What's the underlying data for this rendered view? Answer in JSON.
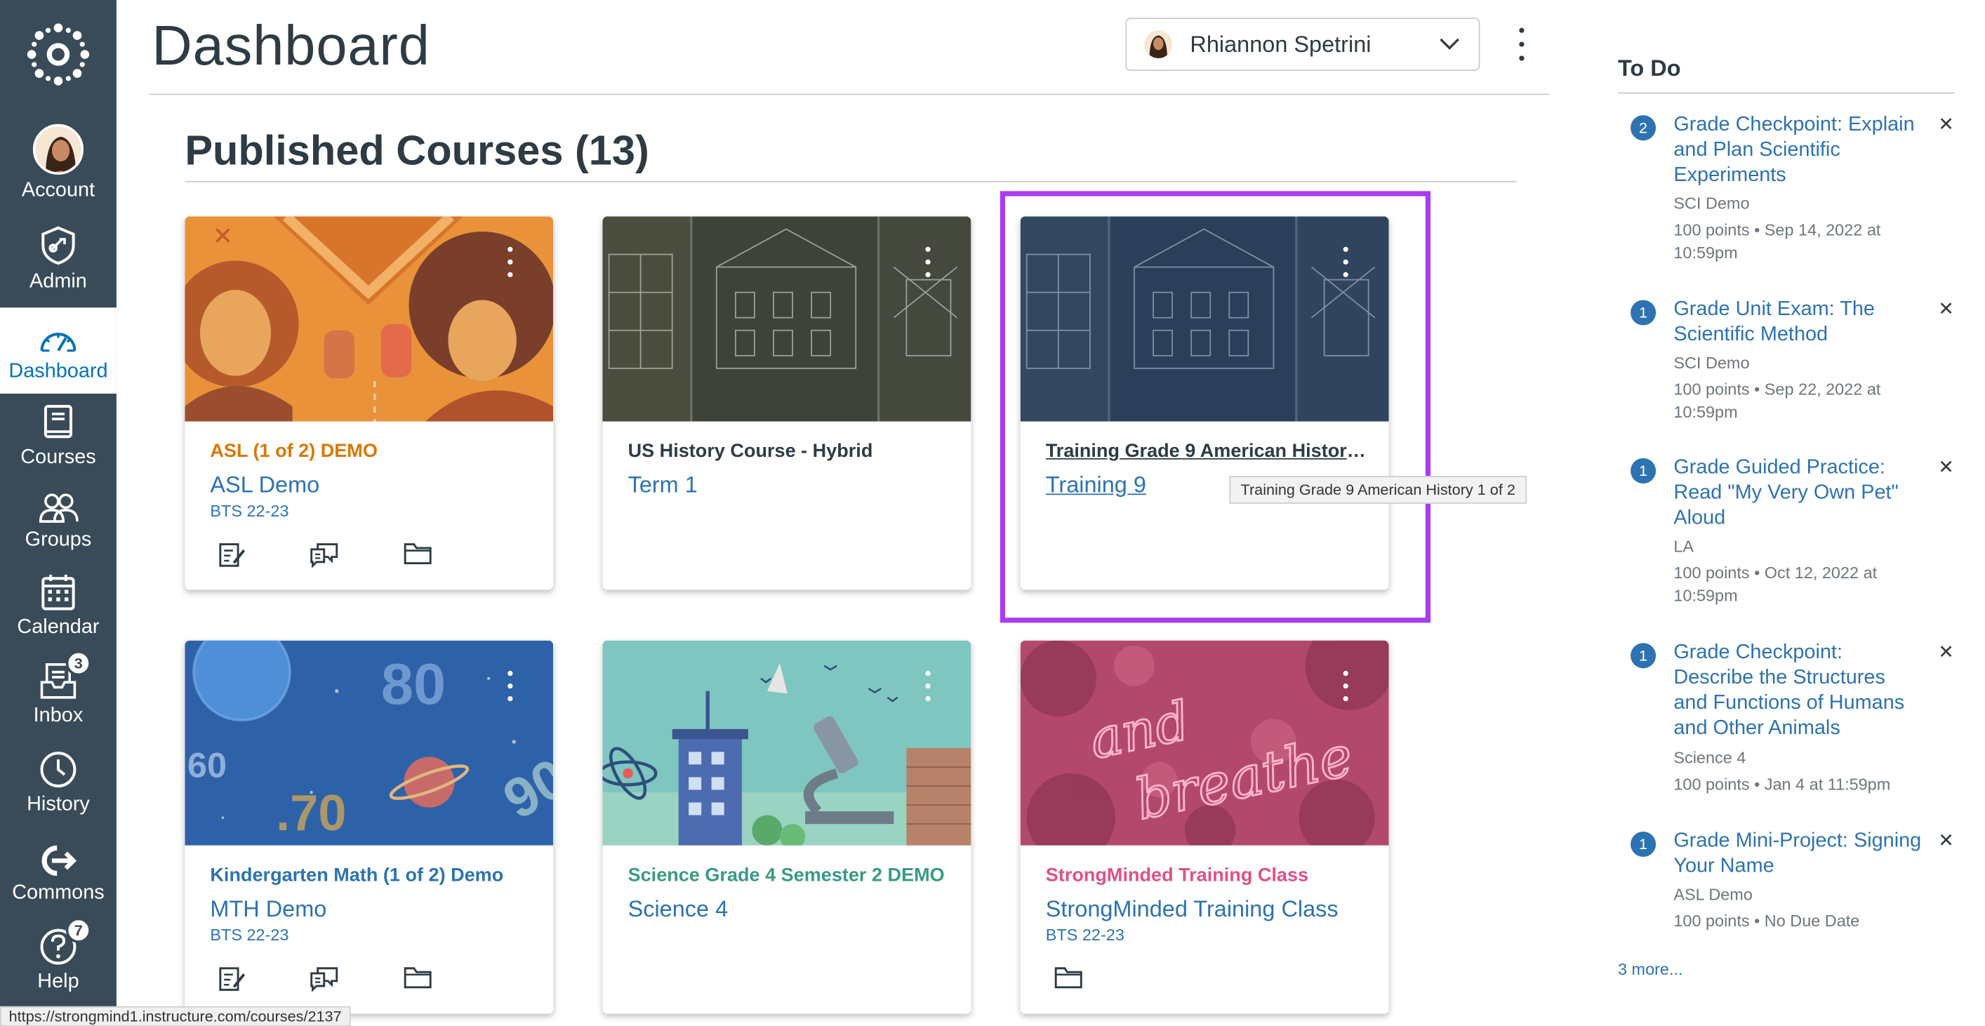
{
  "nav": {
    "account": "Account",
    "admin": "Admin",
    "dashboard": "Dashboard",
    "courses": "Courses",
    "groups": "Groups",
    "calendar": "Calendar",
    "inbox": "Inbox",
    "inbox_badge": "3",
    "history": "History",
    "commons": "Commons",
    "help": "Help",
    "help_badge": "7"
  },
  "header": {
    "title": "Dashboard",
    "user": "Rhiannon Spetrini"
  },
  "section": {
    "title": "Published Courses (13)"
  },
  "courses": [
    {
      "title": "ASL (1 of 2) DEMO",
      "code": "ASL Demo",
      "term": "BTS 22-23",
      "color": "#d97900"
    },
    {
      "title": "US History Course - Hybrid",
      "code": "Term 1",
      "term": "",
      "color": "#2d3b45"
    },
    {
      "title": "Training Grade 9 American History 1 of 2",
      "code": "Training 9",
      "term": "",
      "color": "#2d3b45"
    },
    {
      "title": "Kindergarten Math (1 of 2) Demo",
      "code": "MTH Demo",
      "term": "BTS 22-23",
      "color": "#2d73b1"
    },
    {
      "title": "Science Grade 4 Semester 2 DEMO",
      "code": "Science 4",
      "term": "",
      "color": "#3a9a86"
    },
    {
      "title": "StrongMinded Training Class",
      "code": "StrongMinded Training Class",
      "term": "BTS 22-23",
      "color": "#e0508a"
    }
  ],
  "tooltip": "Training Grade 9 American History 1 of 2",
  "todo": {
    "title": "To Do",
    "items": [
      {
        "badge": "2",
        "title": "Grade Checkpoint: Explain and Plan Scientific Experiments",
        "course": "SCI Demo",
        "meta": "100 points • Sep 14, 2022 at 10:59pm"
      },
      {
        "badge": "1",
        "title": "Grade Unit Exam: The Scientific Method",
        "course": "SCI Demo",
        "meta": "100 points • Sep 22, 2022 at 10:59pm"
      },
      {
        "badge": "1",
        "title": "Grade Guided Practice: Read \"My Very Own Pet\" Aloud",
        "course": "LA",
        "meta": "100 points • Oct 12, 2022 at 10:59pm"
      },
      {
        "badge": "1",
        "title": "Grade Checkpoint: Describe the Structures and Functions of Humans and Other Animals",
        "course": "Science 4",
        "meta": "100 points • Jan 4 at 11:59pm"
      },
      {
        "badge": "1",
        "title": "Grade Mini-Project: Signing Your Name",
        "course": "ASL Demo",
        "meta": "100 points • No Due Date"
      }
    ],
    "more": "3 more..."
  },
  "status_url": "https://strongmind1.instructure.com/courses/2137",
  "colors": {
    "nav_bg": "#394b58",
    "link": "#2d73b1",
    "highlight": "#a93cf0"
  }
}
